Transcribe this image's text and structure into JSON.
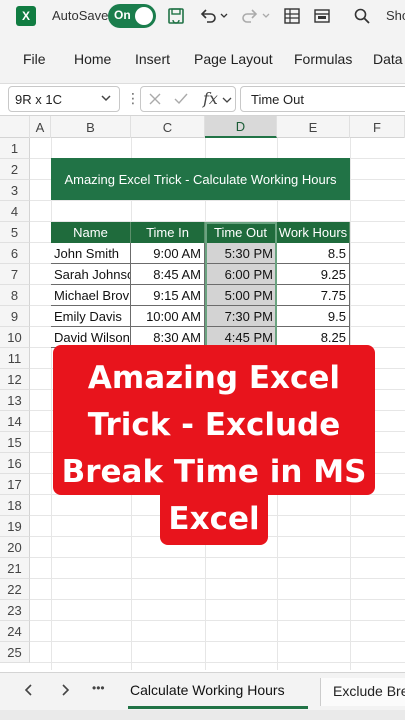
{
  "titlebar": {
    "app_logo": "X",
    "autosave_label": "AutoSave",
    "toggle_label": "On",
    "share_label": "Sho",
    "icons": [
      "save-sync-icon",
      "undo-icon",
      "redo-icon",
      "form-icon",
      "layout-icon",
      "search-icon"
    ]
  },
  "ribbon": {
    "tabs": [
      "File",
      "Home",
      "Insert",
      "Page Layout",
      "Formulas",
      "Data"
    ]
  },
  "formula_bar": {
    "namebox": "9R x 1C",
    "fx": "fx",
    "content": "Time Out"
  },
  "columns": [
    "A",
    "B",
    "C",
    "D",
    "E",
    "F"
  ],
  "rows": [
    "1",
    "2",
    "3",
    "4",
    "5",
    "6",
    "7",
    "8",
    "9",
    "10",
    "11",
    "12",
    "13",
    "14",
    "15",
    "16",
    "17",
    "18",
    "19",
    "20",
    "21",
    "22",
    "23",
    "24",
    "25"
  ],
  "banner": "Amazing Excel Trick - Calculate Working Hours",
  "table": {
    "headers": [
      "Name",
      "Time In",
      "Time Out",
      "Work Hours"
    ],
    "rows": [
      [
        "John Smith",
        "9:00 AM",
        "5:30 PM",
        "8.5"
      ],
      [
        "Sarah Johnso",
        "8:45 AM",
        "6:00 PM",
        "9.25"
      ],
      [
        "Michael Brov",
        "9:15 AM",
        "5:00 PM",
        "7.75"
      ],
      [
        "Emily Davis",
        "10:00 AM",
        "7:30 PM",
        "9.5"
      ],
      [
        "David Wilson",
        "8:30 AM",
        "4:45 PM",
        "8.25"
      ]
    ]
  },
  "overlay": {
    "lines": [
      "Amazing Excel",
      "Trick - Exclude",
      "Break Time in MS",
      "Excel"
    ]
  },
  "sheets": {
    "active": "Calculate Working Hours",
    "other": "Exclude Bre",
    "more": "•••"
  },
  "colors": {
    "excel_green": "#217346",
    "overlay_red": "#e8141c"
  }
}
